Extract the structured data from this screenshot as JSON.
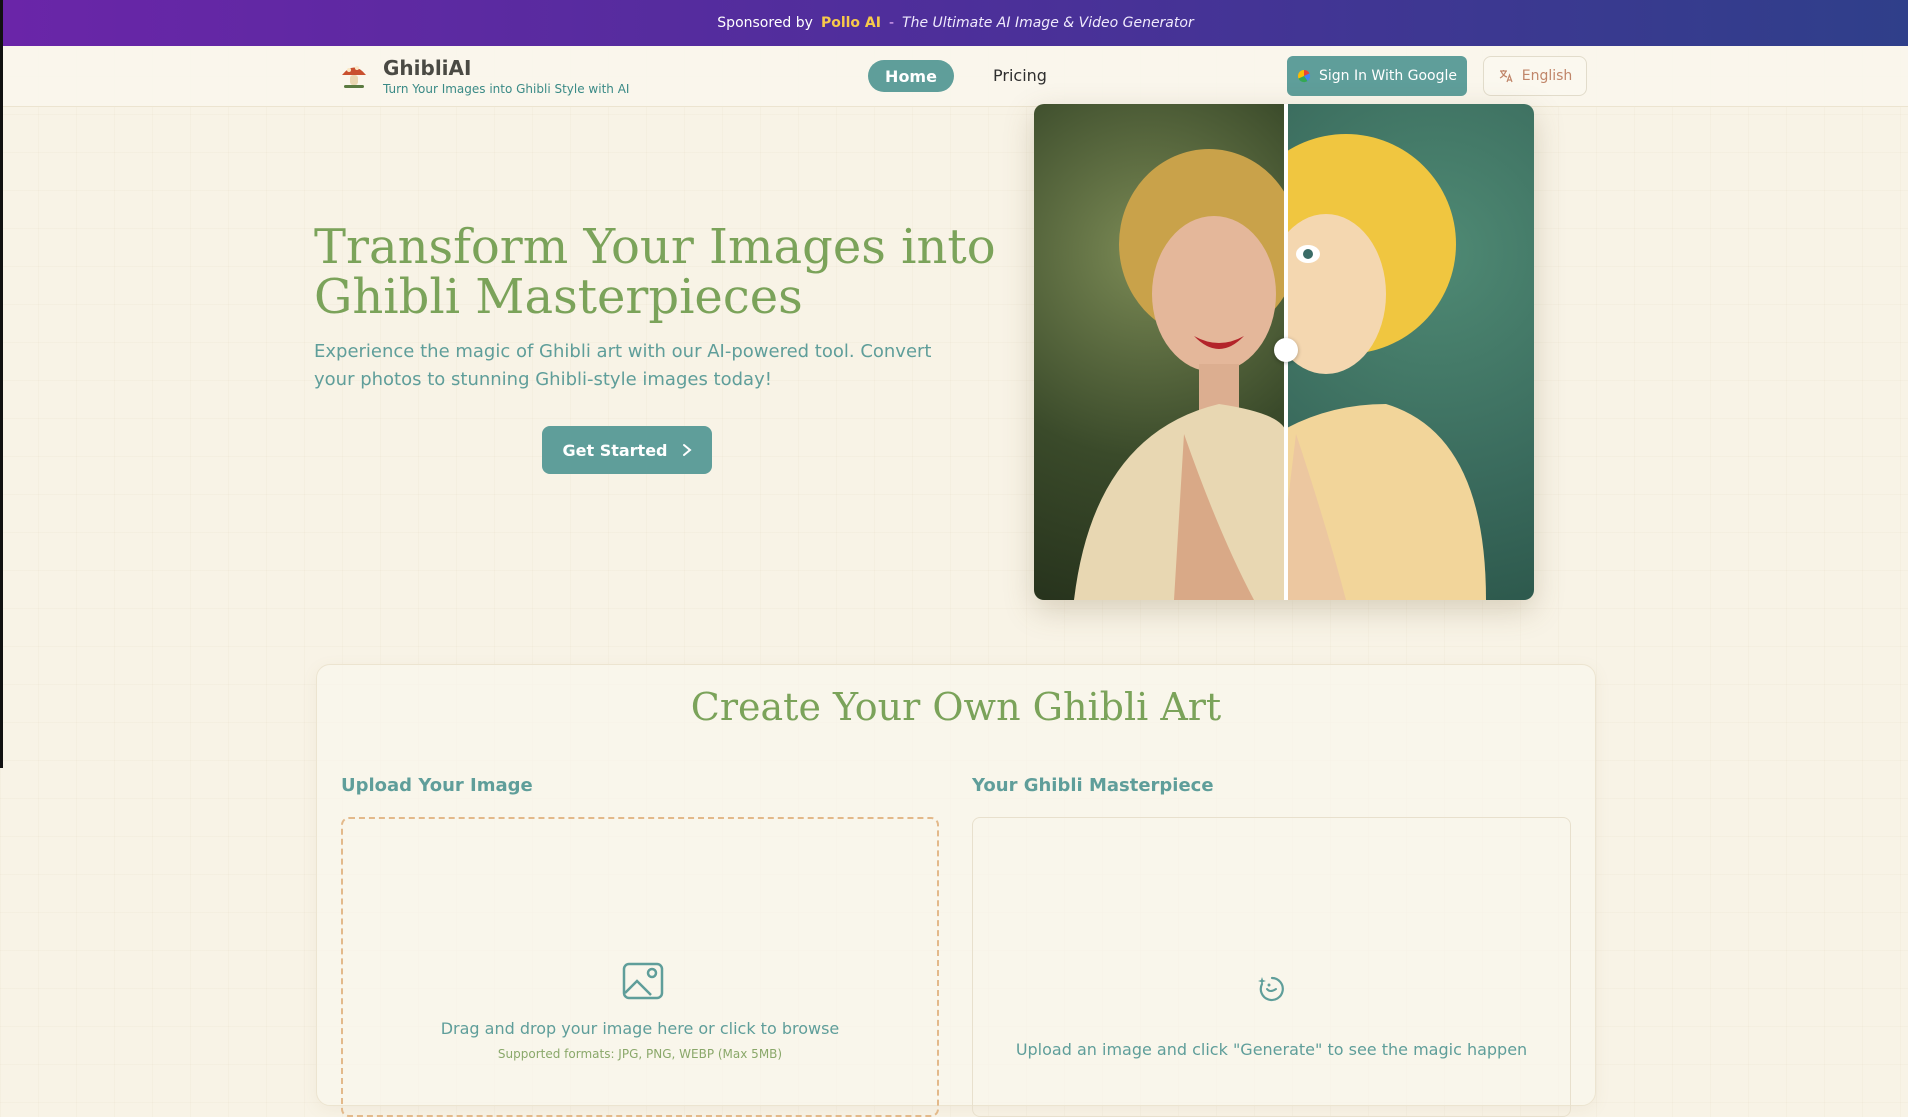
{
  "sponsor": {
    "prefix": "Sponsored by",
    "brand": "Pollo AI",
    "separator": "-",
    "tagline": "The Ultimate AI Image & Video Generator"
  },
  "header": {
    "logo_title": "GhibliAI",
    "logo_subtitle": "Turn Your Images into Ghibli Style with AI",
    "nav": {
      "home": "Home",
      "pricing": "Pricing"
    },
    "signin_label": "Sign In With Google",
    "language_label": "English"
  },
  "hero": {
    "title": "Transform Your Images into Ghibli Masterpieces",
    "subtitle": "Experience the magic of Ghibli art with our AI-powered tool. Convert your photos to stunning Ghibli-style images today!",
    "cta_label": "Get Started"
  },
  "create": {
    "title": "Create Your Own Ghibli Art",
    "upload_label": "Upload Your Image",
    "drop_text": "Drag and drop your image here or click to browse",
    "formats_text": "Supported formats: JPG, PNG, WEBP (Max 5MB)",
    "result_label": "Your Ghibli Masterpiece",
    "result_placeholder": "Upload an image and click \"Generate\" to see the magic happen"
  },
  "colors": {
    "accent": "#5f9e9a",
    "heading_green": "#7ba35a",
    "sponsor_gold": "#f8c94a"
  }
}
